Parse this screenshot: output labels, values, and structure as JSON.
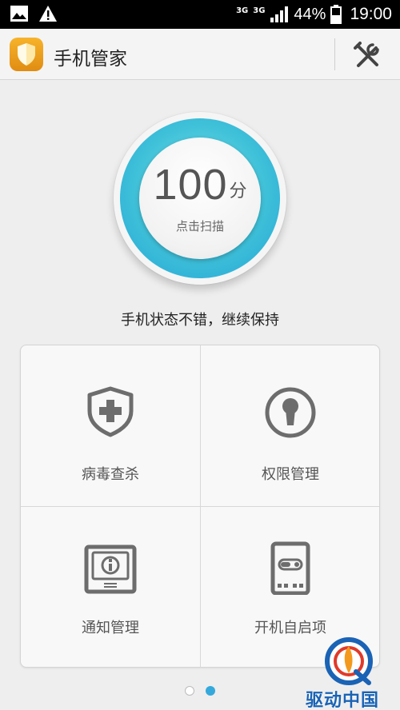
{
  "status_bar": {
    "network_left": "3G",
    "network_right": "3G",
    "battery": "44%",
    "time": "19:00",
    "icons": [
      "image-icon",
      "warning-icon",
      "signal-icon",
      "battery-icon"
    ]
  },
  "app_bar": {
    "title": "手机管家",
    "logo_icon": "shield-logo-icon",
    "tools_icon": "tools-icon"
  },
  "score": {
    "value": "100",
    "unit": "分",
    "action": "点击扫描"
  },
  "status_message": "手机状态不错，继续保持",
  "features": [
    {
      "label": "病毒查杀",
      "icon": "shield-plus-icon"
    },
    {
      "label": "权限管理",
      "icon": "keyhole-icon"
    },
    {
      "label": "通知管理",
      "icon": "notification-icon"
    },
    {
      "label": "开机自启项",
      "icon": "phone-toggle-icon"
    }
  ],
  "pager": {
    "pages": 2,
    "current": 2
  },
  "watermark": {
    "text": "驱动中国"
  },
  "colors": {
    "accent": "#35a9db",
    "ring_light": "#7fe6ea",
    "ring_dark": "#22a3d6",
    "logo": "#f0a020",
    "icon_gray": "#6d6d6d"
  }
}
